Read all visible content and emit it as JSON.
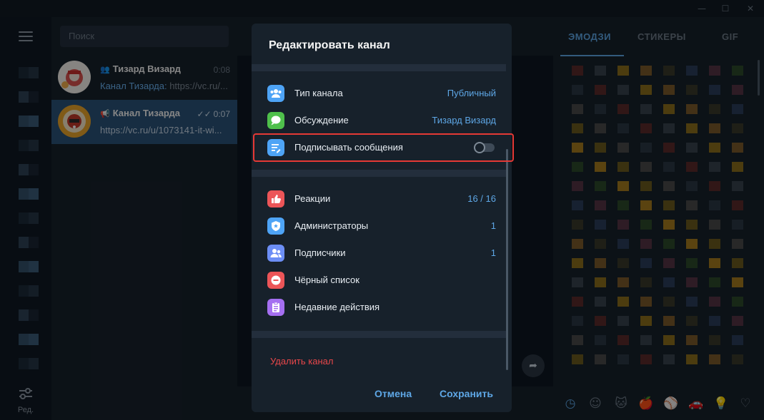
{
  "window": {
    "minimize_glyph": "—",
    "maximize_glyph": "☐",
    "close_glyph": "✕"
  },
  "rail": {
    "settings_label": "Ред."
  },
  "search": {
    "placeholder": "Поиск"
  },
  "chats": [
    {
      "name": "Тизард Визард",
      "type_icon": "group-icon",
      "time": "0:08",
      "preview_sender": "Канал Тизарда:",
      "preview_text": " https://vc.ru/...",
      "active": false
    },
    {
      "name": "Канал Тизарда",
      "type_icon": "channel-icon",
      "time": "0:07",
      "read_mark": "✓✓",
      "preview_text": "https://vc.ru/u/1073141-it-wi...",
      "active": true
    }
  ],
  "emoji_panel": {
    "tabs": [
      "ЭМОДЗИ",
      "СТИКЕРЫ",
      "GIF"
    ],
    "active_tab": 0,
    "categories": [
      "clock-icon",
      "smile-icon",
      "cat-icon",
      "apple-icon",
      "ball-icon",
      "car-icon",
      "bulb-icon",
      "heart-icon"
    ]
  },
  "modal": {
    "title": "Редактировать канал",
    "rows_group1": [
      {
        "label": "Тип канала",
        "value": "Публичный",
        "icon": "channel-type-icon",
        "color": "#4ea4f6"
      },
      {
        "label": "Обсуждение",
        "value": "Тизард Визард",
        "icon": "discussion-icon",
        "color": "#4fc04b"
      },
      {
        "label": "Подписывать сообщения",
        "value": "",
        "icon": "sign-messages-icon",
        "color": "#4ea4f6",
        "toggle": false
      }
    ],
    "rows_group2": [
      {
        "label": "Реакции",
        "value": "16 / 16",
        "icon": "reactions-icon",
        "color": "#ec5558"
      },
      {
        "label": "Администраторы",
        "value": "1",
        "icon": "administrators-icon",
        "color": "#4ea4f6"
      },
      {
        "label": "Подписчики",
        "value": "1",
        "icon": "subscribers-icon",
        "color": "#6c8ef5"
      },
      {
        "label": "Чёрный список",
        "value": "",
        "icon": "blacklist-icon",
        "color": "#ec5558"
      },
      {
        "label": "Недавние действия",
        "value": "",
        "icon": "recent-actions-icon",
        "color": "#a56ff1"
      }
    ],
    "delete_label": "Удалить канал",
    "cancel_label": "Отмена",
    "save_label": "Сохранить"
  },
  "colors": {
    "accent": "#5ea7e6",
    "danger": "#e8474a",
    "highlight": "#e53935",
    "active_chat": "#2b5278"
  }
}
